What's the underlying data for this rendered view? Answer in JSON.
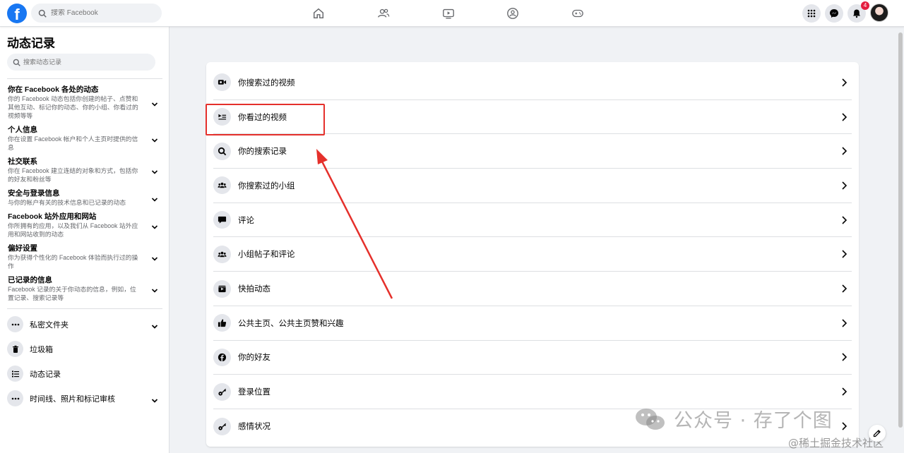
{
  "topbar": {
    "logo_letter": "f",
    "search_placeholder": "搜索 Facebook",
    "nav_icons": [
      "home-icon",
      "friends-icon",
      "video-icon",
      "groups-icon",
      "gaming-icon"
    ],
    "notification_count": "4",
    "accent": "#1877f2"
  },
  "sidebar": {
    "title": "动态记录",
    "search_placeholder": "搜索动态记录",
    "sections": [
      {
        "title": "你在 Facebook 各处的动态",
        "desc": "你的 Facebook 动态包括你创建的帖子、点赞和其他互动、标记你的动态、你的小组、你看过的视频等等"
      },
      {
        "title": "个人信息",
        "desc": "你在设置 Facebook 帐户和个人主页时提供的信息"
      },
      {
        "title": "社交联系",
        "desc": "你在 Facebook 建立连结的对象和方式，包括你的好友和粉丝等"
      },
      {
        "title": "安全与登录信息",
        "desc": "与你的帐户有关的技术信息和已记录的动态"
      },
      {
        "title": "Facebook 站外应用和网站",
        "desc": "你所拥有的应用，以及我们从 Facebook 站外应用和网站收到的动态"
      },
      {
        "title": "偏好设置",
        "desc": "你为获得个性化的 Facebook 体验而执行过的操作"
      },
      {
        "title": "已记录的信息",
        "desc": "Facebook 记录的关于你动态的信息，例如，位置记录、搜索记录等"
      }
    ],
    "items": [
      {
        "label": "私密文件夹",
        "icon": "more-icon",
        "expand": true
      },
      {
        "label": "垃圾箱",
        "icon": "trash-icon",
        "expand": false
      },
      {
        "label": "动态记录",
        "icon": "list-icon",
        "expand": false
      },
      {
        "label": "时间线、照片和标记审核",
        "icon": "more-icon",
        "expand": true
      }
    ]
  },
  "main": {
    "rows": [
      {
        "label": "你搜索过的视频",
        "icon": "video-search-icon"
      },
      {
        "label": "你看过的视频",
        "icon": "watched-video-icon",
        "highlighted": true
      },
      {
        "label": "你的搜索记录",
        "icon": "search-icon"
      },
      {
        "label": "你搜索过的小组",
        "icon": "group-icon"
      },
      {
        "label": "评论",
        "icon": "comment-icon"
      },
      {
        "label": "小组帖子和评论",
        "icon": "group-icon"
      },
      {
        "label": "快拍动态",
        "icon": "stories-icon"
      },
      {
        "label": "公共主页、公共主页赞和兴趣",
        "icon": "like-icon"
      },
      {
        "label": "你的好友",
        "icon": "facebook-icon"
      },
      {
        "label": "登录位置",
        "icon": "key-icon"
      },
      {
        "label": "感情状况",
        "icon": "key-icon"
      }
    ]
  },
  "annotation": {
    "color": "#e5302b"
  },
  "watermark": {
    "text": "公众号 · 存了个图",
    "sub": "@稀土掘金技术社区"
  }
}
